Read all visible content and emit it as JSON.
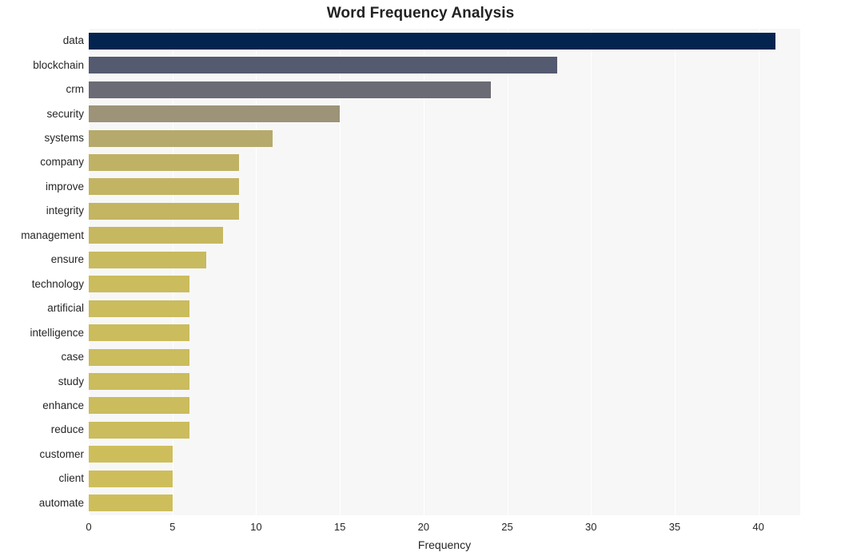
{
  "chart_data": {
    "type": "bar",
    "orientation": "horizontal",
    "title": "Word Frequency Analysis",
    "xlabel": "Frequency",
    "ylabel": "",
    "xlim": [
      0,
      42.5
    ],
    "ylim": [
      0,
      20
    ],
    "grid": true,
    "legend": null,
    "categories": [
      "data",
      "blockchain",
      "crm",
      "security",
      "systems",
      "company",
      "improve",
      "integrity",
      "management",
      "ensure",
      "technology",
      "artificial",
      "intelligence",
      "case",
      "study",
      "enhance",
      "reduce",
      "customer",
      "client",
      "automate"
    ],
    "values": [
      41,
      28,
      24,
      15,
      11,
      9,
      9,
      9,
      8,
      7,
      6,
      6,
      6,
      6,
      6,
      6,
      6,
      5,
      5,
      5
    ],
    "bar_colors": [
      "#042450",
      "#545a70",
      "#6a6b74",
      "#9c9378",
      "#b5aa6b",
      "#c0b265",
      "#c2b463",
      "#c3b562",
      "#c6b860",
      "#c8ba5f",
      "#cbbc5d",
      "#cbbc5d",
      "#cbbc5d",
      "#cbbc5d",
      "#cbbc5d",
      "#cbbc5d",
      "#cbbc5d",
      "#cebe5b",
      "#cebe5b",
      "#cebe5b"
    ],
    "x_ticks": [
      0,
      5,
      10,
      15,
      20,
      25,
      30,
      35,
      40
    ],
    "x_tick_labels": [
      "0",
      "5",
      "10",
      "15",
      "20",
      "25",
      "30",
      "35",
      "40"
    ],
    "plot_background": "#f7f7f7",
    "figure_background": "#ffffff",
    "gridline_color": "#ffffff",
    "title_color": "#222222",
    "tick_label_color": "#262626"
  }
}
